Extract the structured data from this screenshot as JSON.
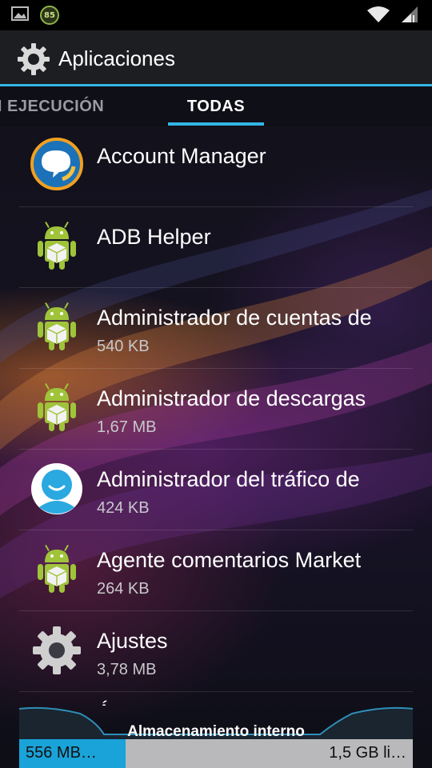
{
  "status_bar": {
    "left_icons": [
      "image-icon",
      "battery-85-icon"
    ],
    "battery_badge": "85",
    "right_icons": [
      "wifi-icon",
      "signal-icon"
    ]
  },
  "action_bar": {
    "icon": "settings-gear-icon",
    "title": "Aplicaciones",
    "accent_color": "#33b5e5"
  },
  "tabs": [
    {
      "label": "N EJECUCIÓN",
      "selected": false
    },
    {
      "label": "TODAS",
      "selected": true
    }
  ],
  "apps": [
    {
      "name": "Account Manager",
      "size": "",
      "icon": "account-manager-icon"
    },
    {
      "name": "ADB Helper",
      "size": "",
      "icon": "android-package-icon"
    },
    {
      "name": "Administrador de cuentas de",
      "size": "540 KB",
      "icon": "android-package-icon"
    },
    {
      "name": "Administrador de descargas",
      "size": "1,67 MB",
      "icon": "android-package-icon"
    },
    {
      "name": "Administrador del tráfico de",
      "size": "424 KB",
      "icon": "user-avatar-icon"
    },
    {
      "name": "Agente comentarios Market",
      "size": "264 KB",
      "icon": "android-package-icon"
    },
    {
      "name": "Ajustes",
      "size": "3,78 MB",
      "icon": "settings-gear-icon"
    },
    {
      "name": "Á",
      "size": "",
      "icon": "partial-app-icon"
    }
  ],
  "storage": {
    "label": "Almacenamiento interno",
    "used_text": "556 MB…",
    "free_text": "1,5 GB li…",
    "used_fraction": 0.27,
    "used_color": "#1aa3d8",
    "free_color": "#b9b9bb"
  }
}
